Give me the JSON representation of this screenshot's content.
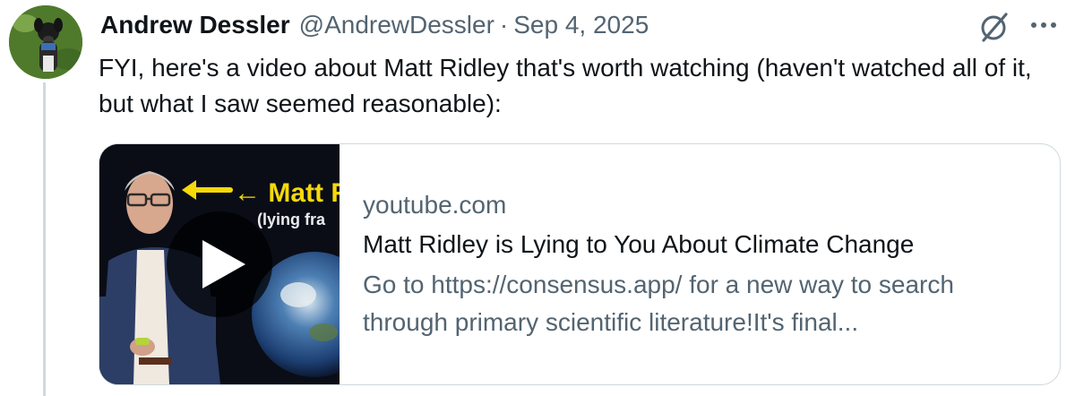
{
  "post": {
    "author_name": "Andrew Dessler",
    "author_handle": "@AndrewDessler",
    "separator": "·",
    "date": "Sep 4, 2025",
    "text": "FYI, here's a video about Matt Ridley that's worth watching (haven't watched all of it, but what I saw seemed reasonable):"
  },
  "icons": {
    "grok": "grok-icon",
    "more": "more-options-icon",
    "play": "play-icon"
  },
  "link_card": {
    "thumbnail_title": "← Matt Ri",
    "thumbnail_subtitle": "(lying fra",
    "domain": "youtube.com",
    "title": "Matt Ridley is Lying to You About Climate Change",
    "description": "Go to https://consensus.app/ for a new way to search through primary scientific literature!It's final..."
  },
  "colors": {
    "text_primary": "#0f1419",
    "text_secondary": "#536471",
    "border": "#cfd9de",
    "thumb_title": "#f5d90a"
  }
}
